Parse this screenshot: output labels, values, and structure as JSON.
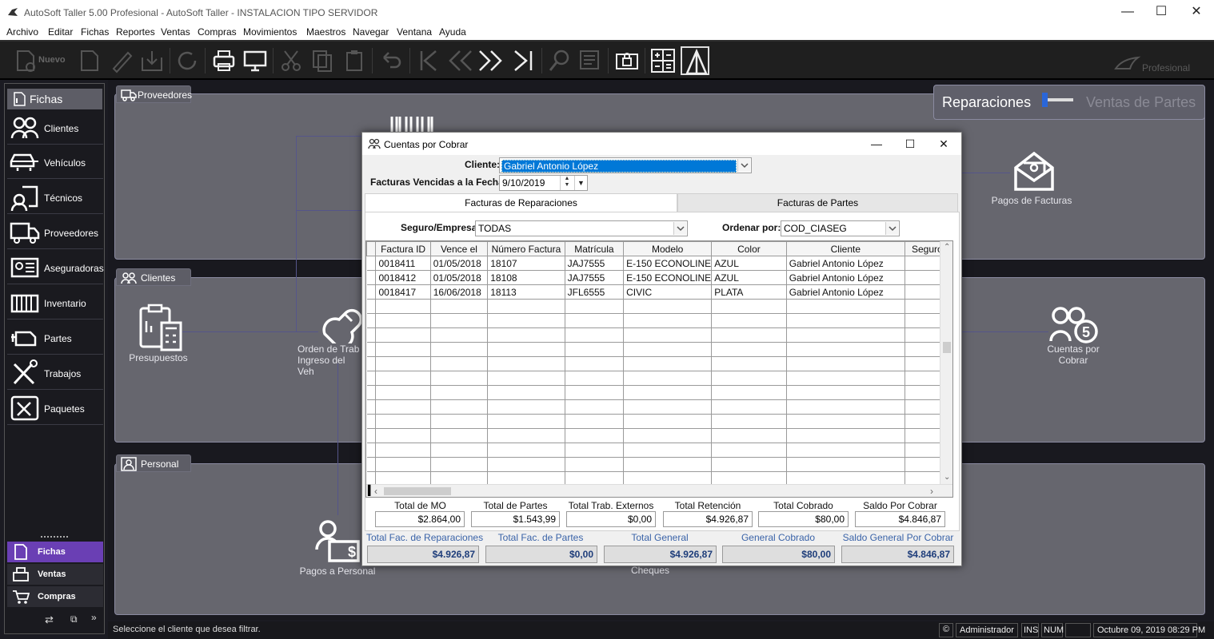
{
  "window": {
    "title": "AutoSoft Taller 5.00 Profesional - AutoSoft Taller - INSTALACION TIPO SERVIDOR"
  },
  "menu": [
    "Archivo",
    "Editar",
    "Fichas",
    "Reportes",
    "Ventas",
    "Compras",
    "Movimientos",
    "Maestros",
    "Navegar",
    "Ventana",
    "Ayuda"
  ],
  "toolbar": {
    "nuevo_label": "Nuevo",
    "edition_label": "Profesional"
  },
  "sidebar": {
    "header": "Fichas",
    "items": [
      {
        "label": "Clientes",
        "icon": "people-icon"
      },
      {
        "label": "Vehículos",
        "icon": "cars-icon"
      },
      {
        "label": "Técnicos",
        "icon": "technician-icon"
      },
      {
        "label": "Proveedores",
        "icon": "truck-icon"
      },
      {
        "label": "Aseguradoras",
        "icon": "insurer-icon"
      },
      {
        "label": "Inventario",
        "icon": "inventory-icon"
      },
      {
        "label": "Partes",
        "icon": "engine-icon"
      },
      {
        "label": "Trabajos",
        "icon": "tools-icon"
      },
      {
        "label": "Paquetes",
        "icon": "package-icon"
      }
    ],
    "bottom": [
      {
        "label": "Fichas",
        "active": true
      },
      {
        "label": "Ventas",
        "active": false
      },
      {
        "label": "Compras",
        "active": false
      }
    ]
  },
  "panels": {
    "proveedores": "Proveedores",
    "clientes": "Clientes",
    "personal": "Personal"
  },
  "flow": {
    "presupuestos": "Presupuestos",
    "orden_line1": "Orden de Trab",
    "orden_line2": "Ingreso del Veh",
    "pagos_facturas": "Pagos de Facturas",
    "cuentas_line1": "Cuentas por",
    "cuentas_line2": "Cobrar",
    "pagos_personal": "Pagos a Personal",
    "cheques": "Cheques"
  },
  "switcher": {
    "left": "Reparaciones",
    "right": "Ventas de Partes"
  },
  "status": {
    "message": "Seleccione el cliente que desea filtrar.",
    "user": "Administrador",
    "ins": "INS",
    "num": "NUM",
    "datetime": "Octubre 09, 2019 08:29 PM"
  },
  "dialog": {
    "title": "Cuentas por Cobrar",
    "cliente_label": "Cliente:",
    "cliente_value": "Gabriel Antonio López",
    "fecha_label": "Facturas Vencidas a la Fecha:",
    "fecha_value": "9/10/2019",
    "tabs": [
      "Facturas de Reparaciones",
      "Facturas de Partes"
    ],
    "seguro_label": "Seguro/Empresa:",
    "seguro_value": "TODAS",
    "ordenar_label": "Ordenar por:",
    "ordenar_value": "COD_CIASEG",
    "columns": [
      "Factura ID",
      "Vence el",
      "Número Factura",
      "Matrícula",
      "Modelo",
      "Color",
      "Cliente",
      "Seguro/"
    ],
    "rows": [
      [
        "0018411",
        "01/05/2018",
        "18107",
        "JAJ7555",
        "E-150 ECONOLINE",
        "AZUL",
        "Gabriel Antonio López",
        ""
      ],
      [
        "0018412",
        "01/05/2018",
        "18108",
        "JAJ7555",
        "E-150 ECONOLINE",
        "AZUL",
        "Gabriel Antonio López",
        ""
      ],
      [
        "0018417",
        "16/06/2018",
        "18113",
        "JFL6555",
        "CIVIC",
        "PLATA",
        "Gabriel Antonio López",
        ""
      ]
    ],
    "totals": [
      {
        "label": "Total de MO",
        "value": "$2.864,00"
      },
      {
        "label": "Total de Partes",
        "value": "$1.543,99"
      },
      {
        "label": "Total Trab. Externos",
        "value": "$0,00"
      },
      {
        "label": "Total Retención",
        "value": "$4.926,87"
      },
      {
        "label": "Total Cobrado",
        "value": "$80,00"
      },
      {
        "label": "Saldo Por Cobrar",
        "value": "$4.846,87"
      }
    ],
    "general": [
      {
        "label": "Total Fac. de Reparaciones",
        "value": "$4.926,87"
      },
      {
        "label": "Total Fac. de Partes",
        "value": "$0,00"
      },
      {
        "label": "Total General",
        "value": "$4.926,87"
      },
      {
        "label": "General Cobrado",
        "value": "$80,00"
      },
      {
        "label": "Saldo General Por Cobrar",
        "value": "$4.846,87"
      }
    ]
  },
  "colors": {
    "accent_purple": "#6a3fb4",
    "selection_blue": "#0078d7",
    "general_text": "#3a63a8"
  }
}
